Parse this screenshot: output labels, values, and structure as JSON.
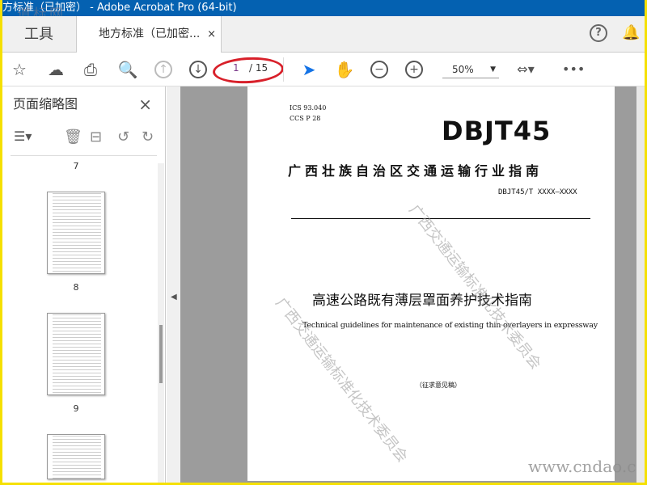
{
  "window": {
    "title": "方标准（已加密） - Adobe Acrobat Pro (64-bit)",
    "watermark": "道标网"
  },
  "tabs": {
    "tools": "工具",
    "document": "地方标准（已加密...",
    "close": "×"
  },
  "header_icons": [
    "help-icon",
    "bell-icon"
  ],
  "toolbar": {
    "page_current": "1",
    "page_total": "/ 15",
    "zoom": "50%"
  },
  "sidebar": {
    "title": "页面缩略图",
    "close": "×",
    "thumbnails": [
      {
        "label": "7"
      },
      {
        "label": "8"
      },
      {
        "label": "9"
      }
    ]
  },
  "document": {
    "ics": "ICS  93.040",
    "ccs": "CCS  P 28",
    "logo": "DBJT45",
    "authority": "广西壮族自治区交通运输行业指南",
    "code": "DBJT45/T XXXX—XXXX",
    "title_cn": "高速公路既有薄层罩面养护技术指南",
    "title_en": "Technical guidelines for maintenance of existing thin overlayers in expressway",
    "draft": "（征求意见稿）",
    "watermark": "广西交通运输标准化技术委员会",
    "site": "www.cndao.c"
  }
}
